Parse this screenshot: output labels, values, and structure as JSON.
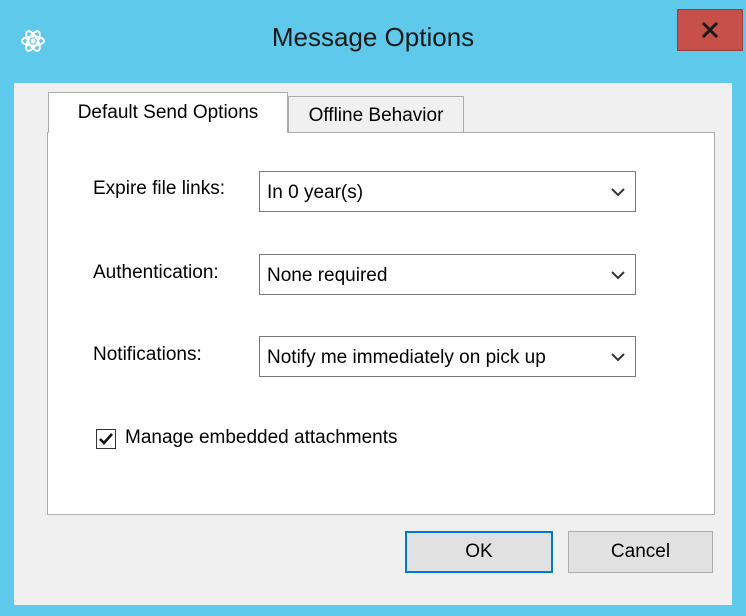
{
  "window": {
    "title": "Message Options",
    "app_icon": "atom-icon",
    "close_icon": "close-icon",
    "close_label": "x"
  },
  "tabs": [
    {
      "label": "Default Send Options",
      "active": true
    },
    {
      "label": "Offline Behavior",
      "active": false
    }
  ],
  "form": {
    "expire": {
      "label": "Expire file links:",
      "value": "In 0 year(s)"
    },
    "authentication": {
      "label": "Authentication:",
      "value": "None required"
    },
    "notifications": {
      "label": "Notifications:",
      "value": "Notify me immediately on pick up"
    },
    "embedded": {
      "label": "Manage embedded attachments",
      "checked": true
    }
  },
  "buttons": {
    "ok": "OK",
    "cancel": "Cancel"
  },
  "colors": {
    "titlebar": "#5ec9ea",
    "close": "#c7504a",
    "client": "#f0f0f0"
  }
}
